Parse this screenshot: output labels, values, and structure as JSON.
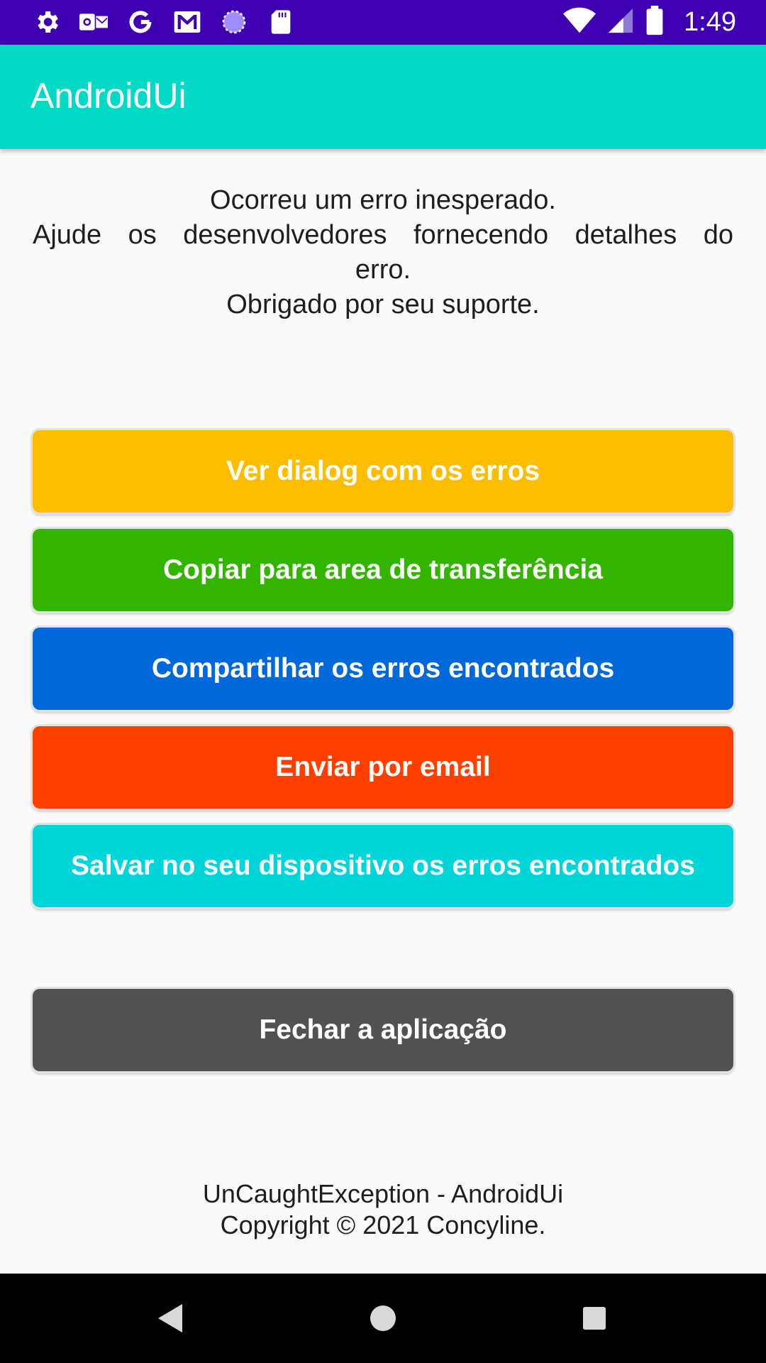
{
  "status_bar": {
    "time": "1:49",
    "left_icons": [
      "settings-icon",
      "outlook-icon",
      "google-icon",
      "gmail-icon",
      "sync-icon",
      "sd-card-icon"
    ],
    "right_icons": [
      "wifi-icon",
      "cell-signal-icon",
      "battery-icon"
    ],
    "background": "#3f00b1"
  },
  "app_bar": {
    "title": "AndroidUi",
    "background": "#03dac5"
  },
  "message": {
    "line1": "Ocorreu um erro inesperado.",
    "line2": "Ajude os desenvolvedores fornecendo detalhes do",
    "line3": "erro.",
    "line4": "Obrigado por seu suporte."
  },
  "buttons": [
    {
      "label": "Ver dialog com os erros",
      "color": "#ffbd00"
    },
    {
      "label": "Copiar para area de transferência",
      "color": "#33b500"
    },
    {
      "label": "Compartilhar os erros encontrados",
      "color": "#0068d9"
    },
    {
      "label": "Enviar por email",
      "color": "#ff3f00"
    },
    {
      "label": "Salvar no seu dispositivo os erros encontrados",
      "color": "#00d6d9"
    }
  ],
  "close_button": {
    "label": "Fechar a aplicação",
    "color": "#525252"
  },
  "footer": {
    "line1": "UnCaughtException - AndroidUi",
    "line2": "Copyright © 2021 Concyline."
  },
  "nav_bar": {
    "icons": [
      "back-icon",
      "home-icon",
      "recents-icon"
    ]
  }
}
